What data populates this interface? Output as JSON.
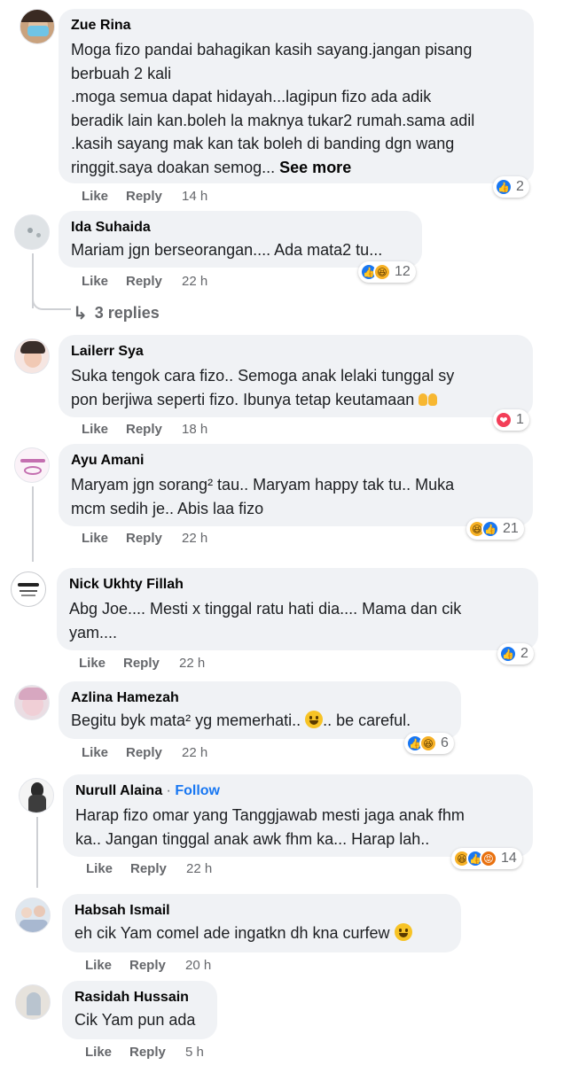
{
  "actions": {
    "like": "Like",
    "reply": "Reply"
  },
  "comments": [
    {
      "author": "Zue Rina",
      "text": "Moga fizo pandai bahagikan kasih sayang.jangan pisang\nberbuah 2 kali\n.moga semua dapat hidayah...lagipun fizo ada adik\nberadik lain kan.boleh la maknya tukar2 rumah.sama adil\n.kasih sayang mak kan tak boleh di banding dgn wang\nringgit.saya doakan semog...",
      "see_more": "See more",
      "time": "14 h",
      "reaction_icons": [
        "like-icon"
      ],
      "reaction_count": "2"
    },
    {
      "author": "Ida Suhaida",
      "text": "Mariam jgn berseorangan.... Ada mata2 tu...",
      "time": "22 h",
      "reaction_icons": [
        "like-icon",
        "haha-icon"
      ],
      "reaction_count": "12",
      "replies": "3 replies"
    },
    {
      "author": "Lailerr Sya",
      "text": "Suka tengok cara fizo.. Semoga anak lelaki tunggal sy\npon berjiwa seperti fizo. Ibunya tetap keutamaan",
      "time": "18 h",
      "reaction_icons": [
        "love-icon"
      ],
      "reaction_count": "1"
    },
    {
      "author": "Ayu Amani",
      "text": "Maryam jgn sorang² tau.. Maryam happy tak tu.. Muka\nmcm sedih je.. Abis laa fizo",
      "time": "22 h",
      "reaction_icons": [
        "haha-icon",
        "like-icon"
      ],
      "reaction_count": "21"
    },
    {
      "author": "Nick Ukhty Fillah",
      "text": "Abg Joe.... Mesti x tinggal ratu hati dia.... Mama dan cik\nyam....",
      "time": "22 h",
      "reaction_icons": [
        "like-icon"
      ],
      "reaction_count": "2"
    },
    {
      "author": "Azlina Hamezah",
      "text": "Begitu byk mata² yg memerhati..",
      "text_after": ".. be careful.",
      "time": "22 h",
      "reaction_icons": [
        "like-icon",
        "haha-icon"
      ],
      "reaction_count": "6"
    },
    {
      "author": "Nurull Alaina",
      "follow": "Follow",
      "text": "Harap fizo omar yang Tanggjawab mesti jaga anak fhm\nka.. Jangan tinggal anak awk fhm ka... Harap lah..",
      "time": "22 h",
      "reaction_icons": [
        "haha-icon",
        "like-icon",
        "angry-icon"
      ],
      "reaction_count": "14"
    },
    {
      "author": "Habsah Ismail",
      "text": "eh cik Yam comel ade ingatkn dh kna curfew",
      "time": "20 h"
    },
    {
      "author": "Rasidah Hussain",
      "text": "Cik Yam pun ada",
      "time": "5 h"
    }
  ],
  "colors": {
    "bubble": "#f0f2f5",
    "secondary_text": "#65676b",
    "like_blue": "#1877f2",
    "love_red": "#f33e58",
    "haha_yellow": "#f7b125"
  }
}
